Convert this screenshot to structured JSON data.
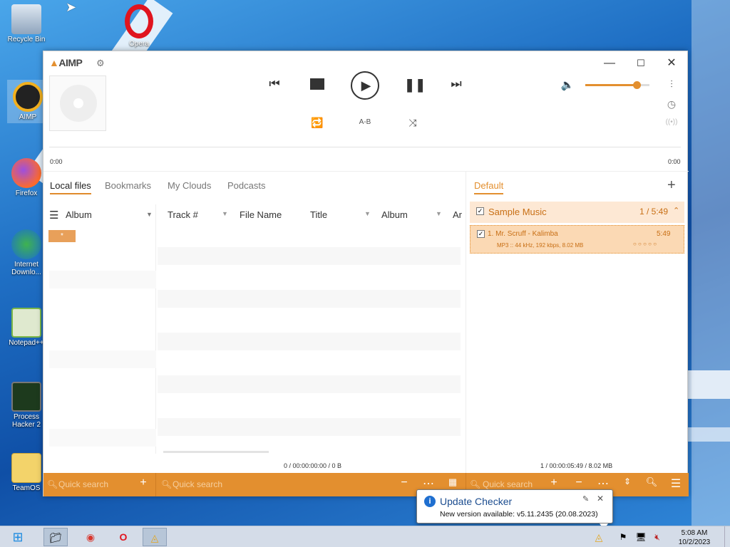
{
  "desktop": {
    "icons": [
      {
        "label": "Recycle Bin",
        "icon": "recycle-bin-icon"
      },
      {
        "label": "Opera",
        "icon": "opera-icon"
      },
      {
        "label": "AIMP",
        "icon": "aimp-icon"
      },
      {
        "label": "Firefox",
        "icon": "firefox-icon"
      },
      {
        "label": "Internet Downlo...",
        "icon": "internet-download-icon"
      },
      {
        "label": "Notepad++",
        "icon": "notepad-icon"
      },
      {
        "label": "Process Hacker 2",
        "icon": "process-hacker-icon"
      },
      {
        "label": "TeamOS",
        "icon": "folder-icon"
      }
    ]
  },
  "player": {
    "logo": "AIMP",
    "time_elapsed": "0:00",
    "time_total": "0:00",
    "ab_label": "A-B",
    "volume_percent": 80,
    "colors": {
      "accent": "#e38f2f",
      "panel_header": "#fde8d4",
      "track_row": "#fbd9b4"
    }
  },
  "library": {
    "tabs": [
      "Local files",
      "Bookmarks",
      "My Clouds",
      "Podcasts"
    ],
    "grouping": "Album",
    "group_item": "*",
    "columns": [
      "Track #",
      "File Name",
      "Title",
      "Album",
      "Ar"
    ],
    "summary": "0 / 00:00:00:00 / 0 B",
    "search_left_placeholder": "Quick search",
    "search_mid_placeholder": "Quick search"
  },
  "playlist": {
    "tab": "Default",
    "group": {
      "name": "Sample Music",
      "info": "1 / 5:49"
    },
    "tracks": [
      {
        "title": "1. Mr. Scruff - Kalimba",
        "duration": "5:49",
        "details": "MP3 :: 44 kHz, 192 kbps, 8.02 MB",
        "rating": "○ ○ ○ ○ ○"
      }
    ],
    "summary": "1 / 00:00:05:49 / 8.02 MB",
    "search_placeholder": "Quick search"
  },
  "notification": {
    "title": "Update Checker",
    "message": "New version available: v5.11.2435 (20.08.2023)"
  },
  "taskbar": {
    "time": "5:08 AM",
    "date": "10/2/2023"
  }
}
